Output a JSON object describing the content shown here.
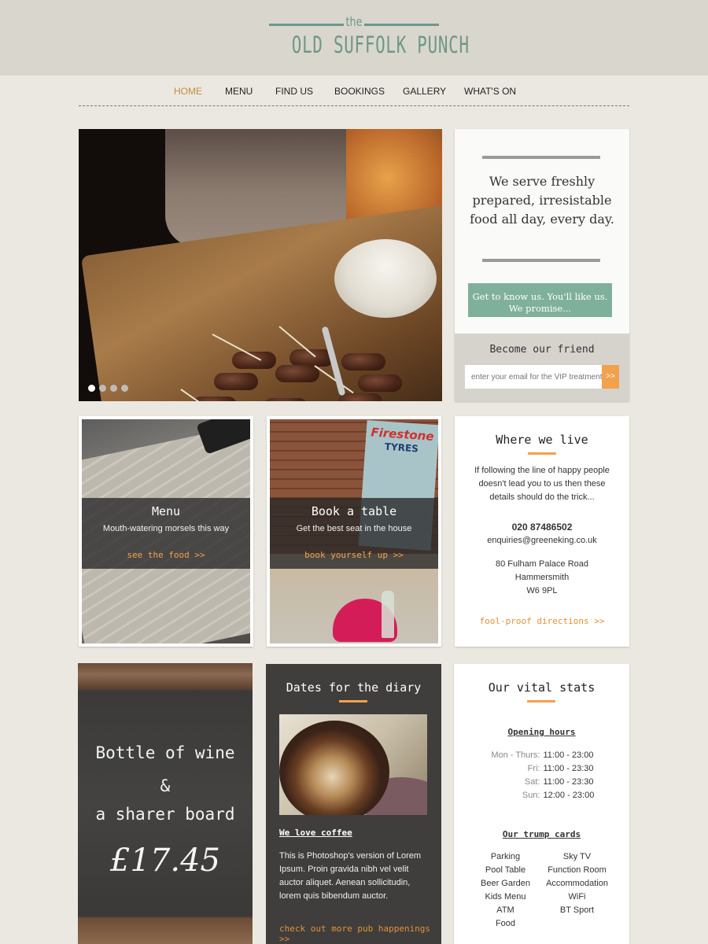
{
  "logo": {
    "the": "the",
    "name": "OLD SUFFOLK PUNCH"
  },
  "nav": [
    {
      "label": "HOME",
      "active": true
    },
    {
      "label": "MENU",
      "active": false
    },
    {
      "label": "FIND US",
      "active": false
    },
    {
      "label": "BOOKINGS",
      "active": false
    },
    {
      "label": "GALLERY",
      "active": false
    },
    {
      "label": "WHAT'S ON",
      "active": false
    }
  ],
  "hero": {
    "slide_count": 4,
    "active_slide": 1
  },
  "intro": {
    "tagline": "We serve freshly prepared, irresistable food all day, every day.",
    "cta": "Get to know us. You'll like us. We promise...",
    "friend_title": "Become our friend",
    "email_placeholder": "enter your email for the VIP treatment",
    "submit": ">>"
  },
  "tiles": {
    "menu": {
      "title": "Menu",
      "subtitle": "Mouth-watering morsels this way",
      "link": "see the food >>"
    },
    "book": {
      "title": "Book a table",
      "subtitle": "Get the best seat in the house",
      "link": "book yourself up >>",
      "sign_line1": "Firestone",
      "sign_line2": "TYRES"
    }
  },
  "where": {
    "title": "Where we live",
    "intro": "If following the line of happy people doesn't lead you to us then these details should do the trick...",
    "phone": "020 87486502",
    "email": "enquiries@greeneking.co.uk",
    "address": [
      "80 Fulham Palace Road",
      "Hammersmith",
      "W6 9PL"
    ],
    "link": "fool-proof directions >>"
  },
  "offer": {
    "line1": "Bottle of wine",
    "line2": "&",
    "line3": "a sharer board",
    "price": "£17.45"
  },
  "dates": {
    "title": "Dates for the diary",
    "subtitle": "We love coffee",
    "body": "This is Photoshop's version  of Lorem Ipsum. Proin gravida nibh vel velit auctor aliquet. Aenean sollicitudin, lorem quis bibendum auctor.",
    "link": "check out more pub happenings >>"
  },
  "stats": {
    "title": "Our vital stats",
    "hours_title": "Opening hours",
    "hours": [
      {
        "day": "Mon - Thurs:",
        "time": "11:00 - 23:00"
      },
      {
        "day": "Fri:",
        "time": "11:00 - 23:30"
      },
      {
        "day": "Sat:",
        "time": "11:00 - 23:30"
      },
      {
        "day": "Sun:",
        "time": "12:00 - 23:00"
      }
    ],
    "trumps_title": "Our trump cards",
    "trumps": [
      "Parking",
      "Sky TV",
      "Pool Table",
      "Function Room",
      "Beer Garden",
      "Accommodation",
      "Kids Menu",
      "WiFi",
      "ATM",
      "BT Sport",
      "Food"
    ]
  },
  "colors": {
    "accent_green": "#7fb09b",
    "accent_orange": "#f2a14c",
    "nav_active": "#c98a3e"
  }
}
